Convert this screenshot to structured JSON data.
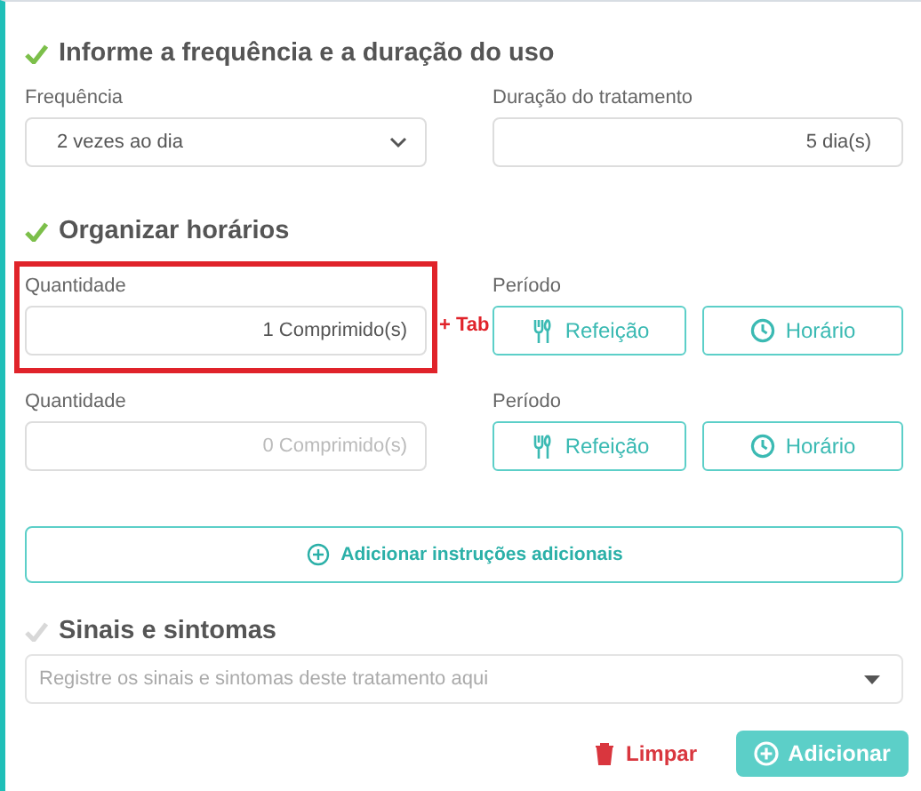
{
  "sections": [
    {
      "kind": "fields",
      "title": "Informe a frequência e a duração do uso",
      "done": true,
      "fields": [
        {
          "kind": "select",
          "label": "Frequência",
          "value": "2 vezes ao dia"
        },
        {
          "kind": "number",
          "label": "Duração do tratamento",
          "value": "5 dia(s)"
        }
      ]
    },
    {
      "kind": "schedule",
      "title": "Organizar horários",
      "done": true,
      "rows": [
        {
          "quantity_label": "Quantidade",
          "quantity": "1 Comprimido(s)",
          "filled": true,
          "highlighted": true,
          "annotation": "+ Tab",
          "period_label": "Período",
          "buttons": [
            "Refeição",
            "Horário"
          ]
        },
        {
          "quantity_label": "Quantidade",
          "quantity": "0 Comprimido(s)",
          "filled": false,
          "highlighted": false,
          "period_label": "Período",
          "buttons": [
            "Refeição",
            "Horário"
          ]
        }
      ],
      "add_button": "Adicionar instruções adicionais"
    },
    {
      "kind": "combo",
      "title": "Sinais e sintomas",
      "done": false,
      "placeholder": "Registre os sinais e sintomas deste tratamento aqui"
    }
  ],
  "actions": {
    "clear": "Limpar",
    "submit": "Adicionar"
  }
}
